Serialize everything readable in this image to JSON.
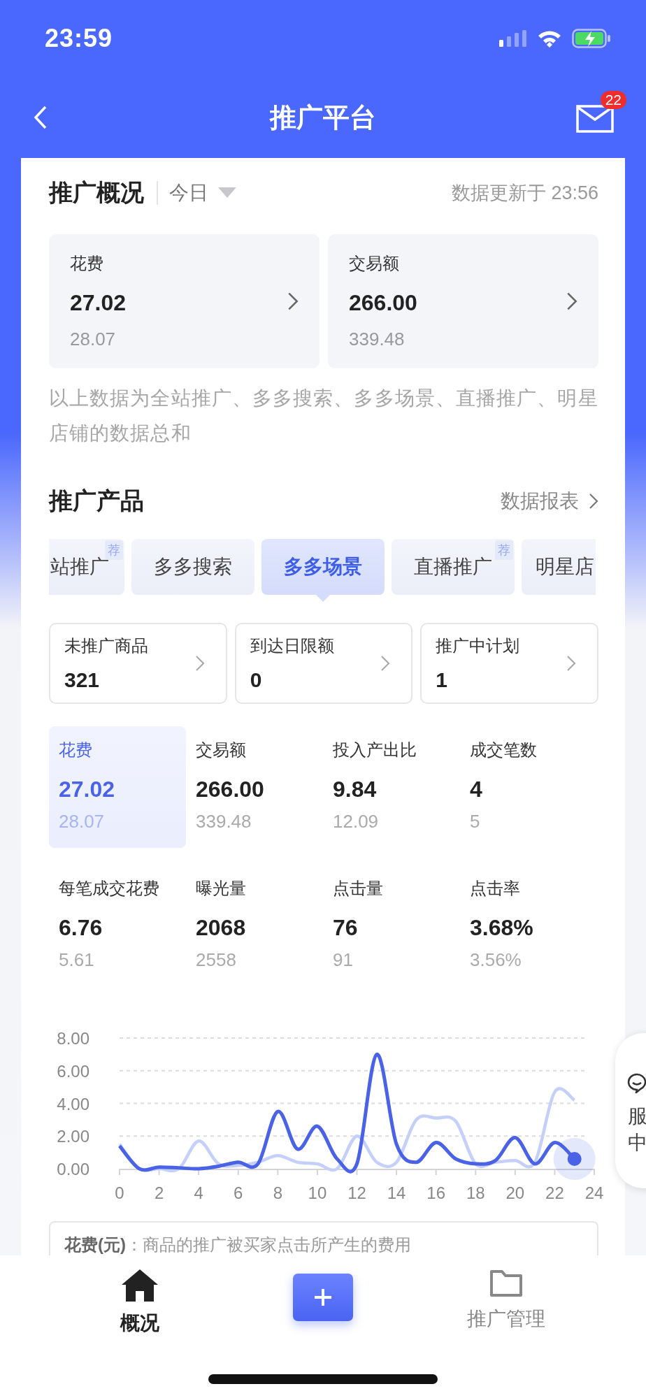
{
  "status_bar": {
    "time": "23:59"
  },
  "nav_bar": {
    "title": "推广平台",
    "mail_badge": "22"
  },
  "overview": {
    "title": "推广概况",
    "period": "今日",
    "updated": "数据更新于 23:56",
    "cards": [
      {
        "label": "花费",
        "value": "27.02",
        "previous": "28.07"
      },
      {
        "label": "交易额",
        "value": "266.00",
        "previous": "339.48"
      }
    ],
    "note": "以上数据为全站推广、多多搜索、多多场景、直播推广、明星店铺的数据总和"
  },
  "products": {
    "title": "推广产品",
    "report_link": "数据报表",
    "tabs": [
      {
        "label": "站推广",
        "badge": "荐",
        "selected": false
      },
      {
        "label": "多多搜索",
        "selected": false
      },
      {
        "label": "多多场景",
        "selected": true
      },
      {
        "label": "直播推广",
        "badge": "荐",
        "selected": false
      },
      {
        "label": "明星店",
        "selected": false
      }
    ],
    "stat_boxes": [
      {
        "label": "未推广商品",
        "value": "321"
      },
      {
        "label": "到达日限额",
        "value": "0"
      },
      {
        "label": "推广中计划",
        "value": "1"
      }
    ],
    "metrics": [
      {
        "label": "花费",
        "value": "27.02",
        "previous": "28.07",
        "selected": true
      },
      {
        "label": "交易额",
        "value": "266.00",
        "previous": "339.48",
        "selected": false
      },
      {
        "label": "投入产出比",
        "value": "9.84",
        "previous": "12.09",
        "selected": false
      },
      {
        "label": "成交笔数",
        "value": "4",
        "previous": "5",
        "selected": false
      },
      {
        "label": "每笔成交花费",
        "value": "6.76",
        "previous": "5.61",
        "selected": false
      },
      {
        "label": "曝光量",
        "value": "2068",
        "previous": "2558",
        "selected": false
      },
      {
        "label": "点击量",
        "value": "76",
        "previous": "91",
        "selected": false
      },
      {
        "label": "点击率",
        "value": "3.68%",
        "previous": "3.56%",
        "selected": false
      }
    ],
    "chart_data": {
      "type": "line",
      "grid": true,
      "x": [
        0,
        1,
        2,
        3,
        4,
        5,
        6,
        7,
        8,
        9,
        10,
        11,
        12,
        13,
        14,
        15,
        16,
        17,
        18,
        19,
        20,
        21,
        22,
        23
      ],
      "xlim": [
        0,
        24
      ],
      "ylim": [
        0,
        8
      ],
      "xticks": [
        0,
        2,
        4,
        6,
        8,
        10,
        12,
        14,
        16,
        18,
        20,
        22,
        24
      ],
      "yticks": [
        {
          "value": 0,
          "label": "0.00"
        },
        {
          "value": 2,
          "label": "2.00"
        },
        {
          "value": 4,
          "label": "4.00"
        },
        {
          "value": 6,
          "label": "6.00"
        },
        {
          "value": 8,
          "label": "8.00"
        }
      ],
      "series": [
        {
          "color": "#c5d0fa",
          "values": [
            1.5,
            0,
            0,
            0,
            1.7,
            0.3,
            0.2,
            0.4,
            0.8,
            0.4,
            0.3,
            0,
            2.0,
            0.4,
            0.4,
            3.0,
            3.1,
            2.9,
            0.3,
            0.4,
            0.5,
            0.4,
            4.7,
            4.2
          ]
        },
        {
          "color": "#4a63e6",
          "values": [
            1.4,
            0,
            0.1,
            0.05,
            0,
            0.15,
            0.4,
            0.3,
            3.5,
            1.2,
            2.6,
            0.6,
            0.3,
            7.0,
            1.5,
            0.4,
            1.6,
            0.6,
            0.3,
            0.5,
            1.9,
            0.3,
            1.6,
            0.6
          ]
        }
      ]
    },
    "definition": "**花费(元)**：商品的推广被买家点击所产生的费用"
  },
  "service_tab": {
    "label": "服中"
  },
  "bottom_nav": [
    {
      "kind": "home",
      "label": "概况",
      "selected": true
    },
    {
      "kind": "add"
    },
    {
      "kind": "folder",
      "label": "推广管理",
      "selected": false
    }
  ]
}
